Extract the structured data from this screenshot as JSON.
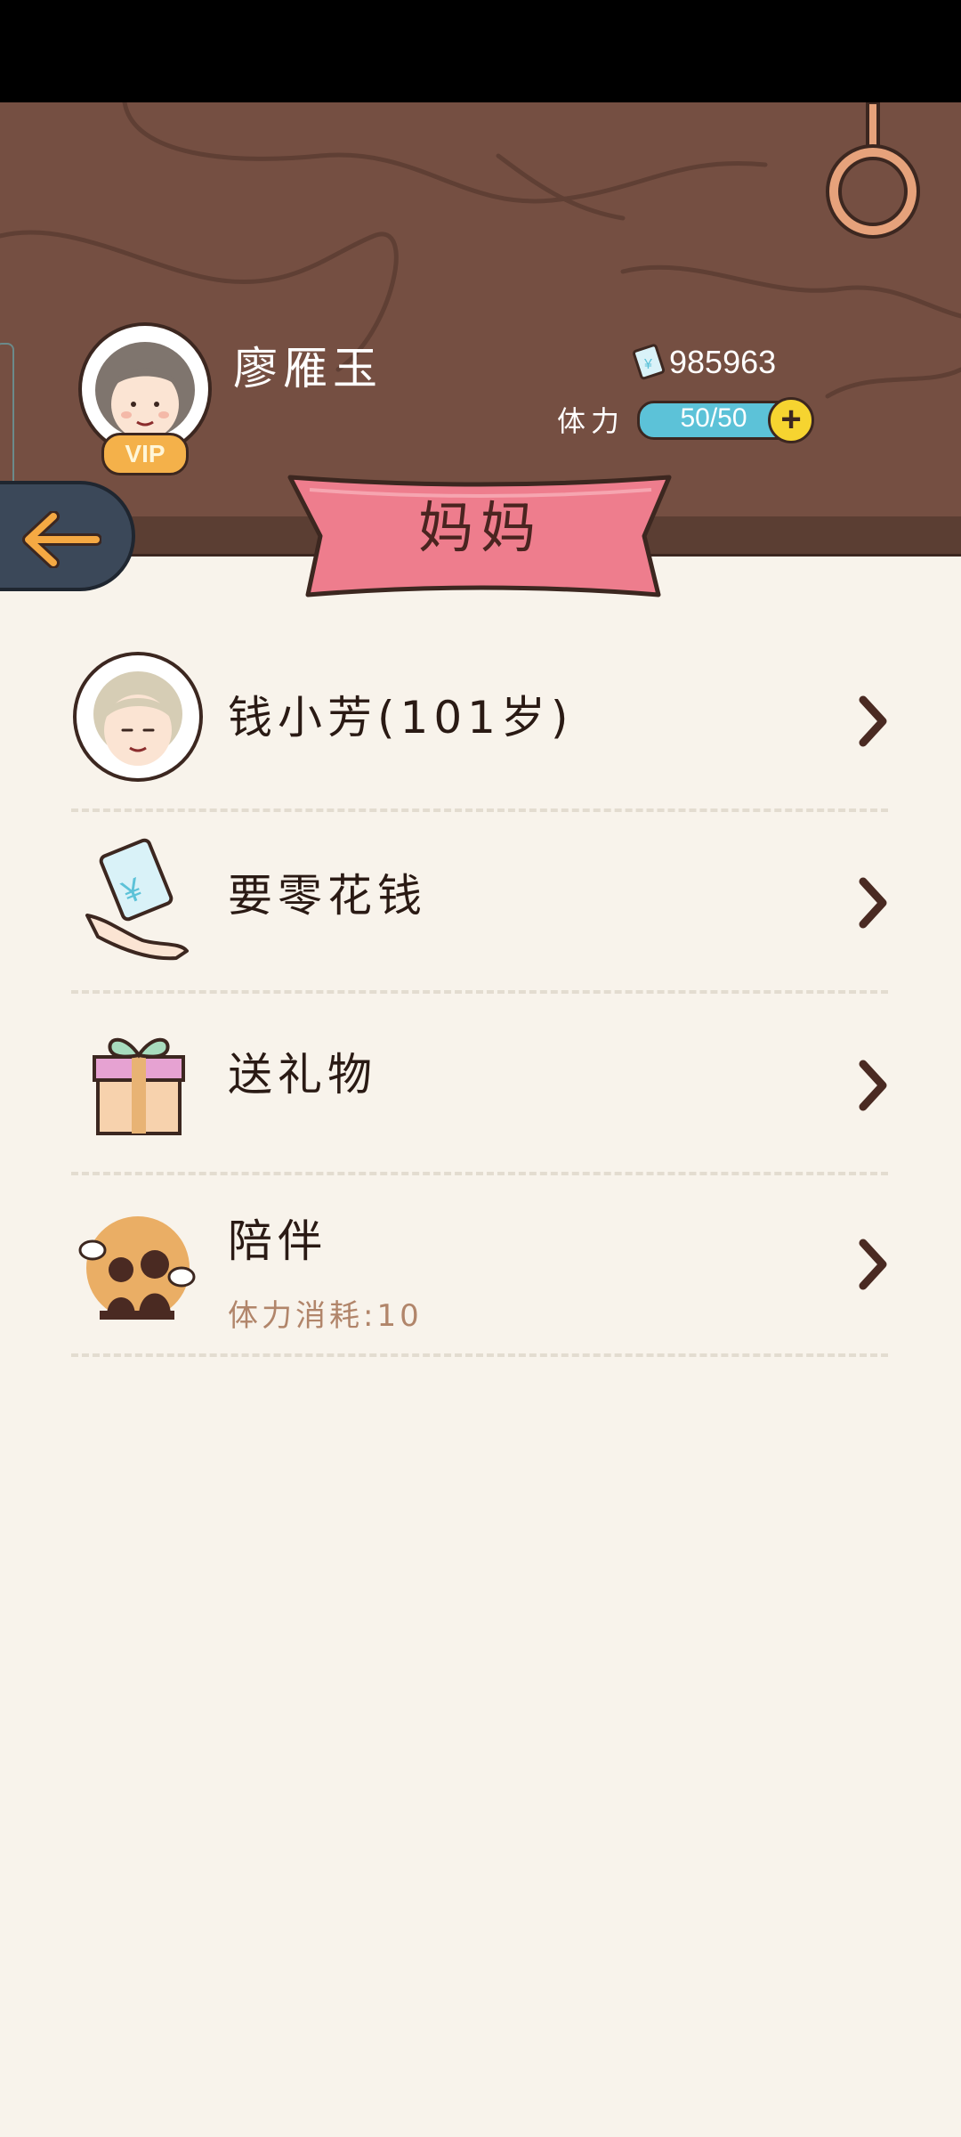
{
  "header": {
    "player_name": "廖雁玉",
    "vip_label": "VIP",
    "money": "985963",
    "stamina_label": "体力",
    "stamina_value": "50/50",
    "stamina_fraction": 1.0
  },
  "banner": {
    "title": "妈妈"
  },
  "menu": {
    "items": [
      {
        "label": "钱小芳(101岁)",
        "icon": "grandma-avatar-icon"
      },
      {
        "label": "要零花钱",
        "icon": "money-hand-icon"
      },
      {
        "label": "送礼物",
        "icon": "gift-icon"
      },
      {
        "label": "陪伴",
        "sublabel": "体力消耗:10",
        "icon": "companion-icon"
      }
    ]
  },
  "colors": {
    "wood": "#754f42",
    "ribbon": "#ee7d8d",
    "stamina": "#5cc2d8",
    "background": "#f8f3eb"
  }
}
